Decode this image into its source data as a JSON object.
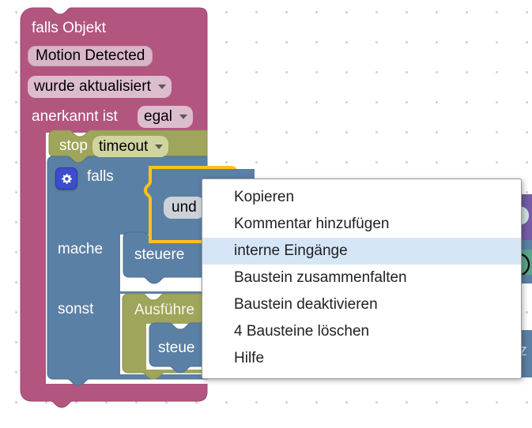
{
  "app": {
    "name": "blockly-workspace",
    "grid_dot_color": "#d0d0d6",
    "background": "#ffffff"
  },
  "blocks": {
    "trigger": {
      "color": "#b2557f",
      "label_if": "falls Objekt",
      "object_field": "Motion Detected",
      "condition_dropdown": "wurde aktualisiert",
      "ack_label": "anerkannt ist",
      "ack_dropdown": "egal"
    },
    "timeout": {
      "color": "#9fa55b",
      "label_stop": "stop",
      "name_dropdown": "timeout"
    },
    "controls_if": {
      "color": "#5b80a5",
      "label_if": "falls",
      "label_do": "mache",
      "label_else": "sonst",
      "mutator_icon": "gear-icon"
    },
    "logic_and": {
      "color": "#5b80a5",
      "label": "und",
      "selected": true,
      "selection_color": "#fcc21b"
    },
    "control_do_1": {
      "color": "#5b80a5",
      "label": "steuere"
    },
    "exec_block": {
      "color": "#9fa55b",
      "label": "Ausführe"
    },
    "control_do_2": {
      "color": "#5b80a5",
      "label": "steue"
    },
    "offscreen": {
      "purple_color": "#745ba5",
      "teal_color": "#5ba58c",
      "blue_color": "#5b80a5",
      "clipped_text": "rz"
    }
  },
  "context_menu": {
    "name": "block-context-menu",
    "highlighted_index": 2,
    "items": [
      {
        "label": "Kopieren"
      },
      {
        "label": "Kommentar hinzufügen"
      },
      {
        "label": "interne Eingänge"
      },
      {
        "label": "Baustein zusammenfalten"
      },
      {
        "label": "Baustein deaktivieren"
      },
      {
        "label": "4 Bausteine löschen"
      },
      {
        "label": "Hilfe"
      }
    ]
  }
}
